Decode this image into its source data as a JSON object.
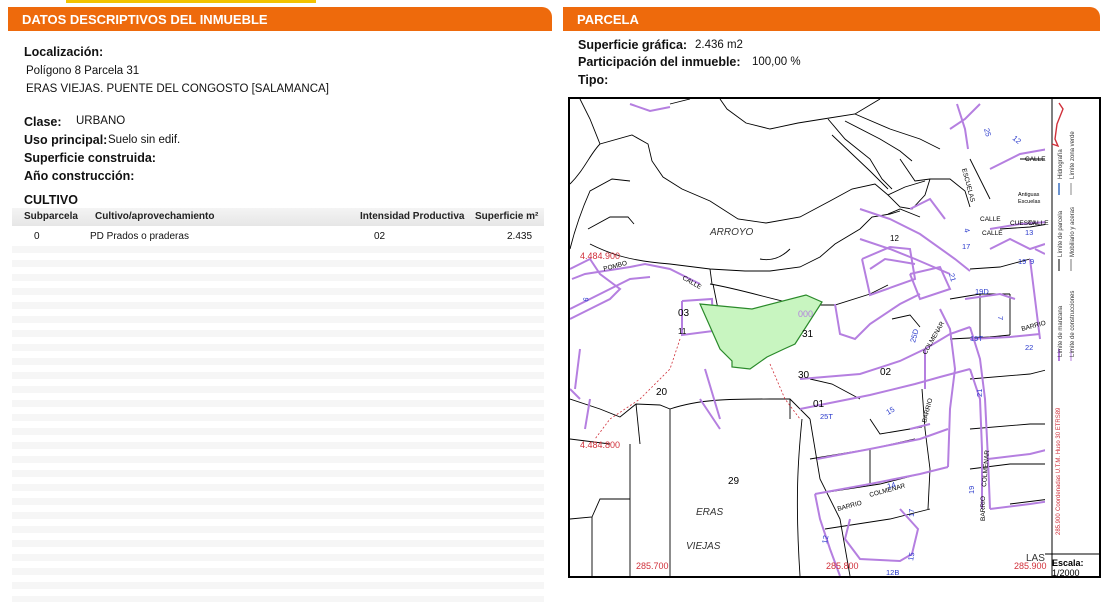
{
  "left_panel": {
    "title": "DATOS DESCRIPTIVOS DEL INMUEBLE",
    "localizacion_label": "Localización:",
    "localizacion_line1": "Polígono 8 Parcela 31",
    "localizacion_line2": "ERAS VIEJAS. PUENTE DEL CONGOSTO [SALAMANCA]",
    "clase_label": "Clase:",
    "clase_value": "URBANO",
    "uso_label": "Uso principal:",
    "uso_value": "Suelo sin edif.",
    "superficie_construida_label": "Superficie construida:",
    "ano_label": "Año construcción:"
  },
  "cultivo": {
    "title": "CULTIVO",
    "headers": [
      "Subparcela",
      "Cultivo/aprovechamiento",
      "Intensidad Productiva",
      "Superficie m²"
    ],
    "rows": [
      [
        "0",
        "PD Prados o praderas",
        "02",
        "2.435"
      ]
    ]
  },
  "right_panel": {
    "title": "PARCELA",
    "superficie_grafica_label": "Superficie gráfica:",
    "superficie_grafica_value": "2.436 m2",
    "participacion_label": "Participación del inmueble:",
    "participacion_value": "100,00 %",
    "tipo_label": "Tipo:"
  },
  "map": {
    "colors": {
      "highlight_fill": "#c8f5c0",
      "highlight_stroke": "#2a8a2a",
      "building_outline": "#b57fe0",
      "coordinate_text": "#d0303a",
      "line": "#000000"
    },
    "coord_labels": [
      "4.484.900",
      "4.484.800",
      "285.700",
      "285.800",
      "285.900"
    ],
    "place_labels": [
      "ARROYO",
      "ERAS",
      "VIEJAS",
      "LAS",
      "POMBO",
      "CALLE",
      "CALLE",
      "CALLE",
      "BARRIO",
      "BARRIO",
      "BARRIO",
      "COLMENAR",
      "COLMENAR",
      "COLMENAR",
      "ESCUELAS",
      "BARRIO",
      "Antiguas",
      "Escuelas",
      "CALLE",
      "CUESTA",
      "CALLE"
    ],
    "parcel_numbers": [
      "03",
      "31",
      "20",
      "30",
      "01",
      "02",
      "29",
      "11",
      "12",
      "000"
    ],
    "street_numbers": [
      "25",
      "12",
      "4",
      "17",
      "21",
      "13",
      "19",
      "9",
      "19D",
      "7",
      "25D",
      "19T",
      "22",
      "25T",
      "15",
      "21",
      "14",
      "19",
      "17",
      "12",
      "15",
      "12B",
      "6"
    ],
    "legend": [
      "Límite de manzana",
      "Límite de construcciones",
      "Límite de parcela",
      "Mobiliario y aceras",
      "Hidrografía",
      "Límite zona verde"
    ],
    "crs_label": "Coordenadas U.T.M. Huso 30 ETRS89",
    "crs_value": "285.900",
    "scale_label": "Escala:",
    "scale_value": "1/2000"
  }
}
